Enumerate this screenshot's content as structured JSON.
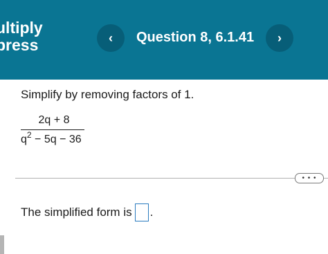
{
  "header": {
    "course_title_line1": "ultiply",
    "course_title_line2": "press",
    "question_label": "Question 8, 6.1.41",
    "prev_icon": "‹",
    "next_icon": "›",
    "background": "#0a7593"
  },
  "question": {
    "instruction": "Simplify by removing factors of 1.",
    "numerator": "2q + 8",
    "denominator_base": "q",
    "denominator_exponent": "2",
    "denominator_rest": " − 5q − 36"
  },
  "divider": {
    "more_label": "• • •"
  },
  "answer": {
    "prefix": "The simplified form is",
    "suffix": "."
  }
}
